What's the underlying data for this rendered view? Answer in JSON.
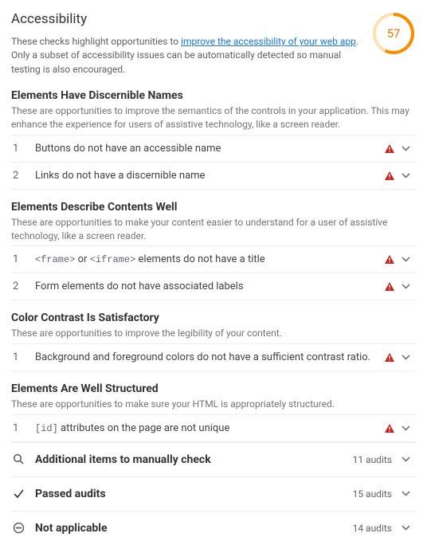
{
  "header": {
    "title": "Accessibility",
    "description_pre": "These checks highlight opportunities to ",
    "description_link": "improve the accessibility of your web app",
    "description_post": ". Only a subset of accessibility issues can be automatically detected so manual testing is also encouraged.",
    "score": "57"
  },
  "gauge": {
    "circumference": 150.8,
    "dashoffset": 64.8,
    "color": "#fb8c00"
  },
  "sections": [
    {
      "title": "Elements Have Discernible Names",
      "desc": "These are opportunities to improve the semantics of the controls in your application. This may enhance the experience for users of assistive technology, like a screen reader.",
      "items": [
        {
          "num": "1",
          "text": "Buttons do not have an accessible name"
        },
        {
          "num": "2",
          "text": "Links do not have a discernible name"
        }
      ]
    },
    {
      "title": "Elements Describe Contents Well",
      "desc": "These are opportunities to make your content easier to understand for a user of assistive technology, like a screen reader.",
      "items": [
        {
          "num": "1",
          "html": "<code>&lt;frame&gt;</code> or <code>&lt;iframe&gt;</code> elements do not have a title"
        },
        {
          "num": "2",
          "text": "Form elements do not have associated labels"
        }
      ]
    },
    {
      "title": "Color Contrast Is Satisfactory",
      "desc": "These are opportunities to improve the legibility of your content.",
      "items": [
        {
          "num": "1",
          "text": "Background and foreground colors do not have a sufficient contrast ratio."
        }
      ]
    },
    {
      "title": "Elements Are Well Structured",
      "desc": "These are opportunities to make sure your HTML is appropriately structured.",
      "items": [
        {
          "num": "1",
          "html": "<code>[id]</code> attributes on the page are not unique"
        }
      ]
    }
  ],
  "summaries": [
    {
      "icon": "search",
      "label": "Additional items to manually check",
      "count": "11 audits"
    },
    {
      "icon": "check",
      "label": "Passed audits",
      "count": "15 audits"
    },
    {
      "icon": "dash",
      "label": "Not applicable",
      "count": "14 audits"
    }
  ]
}
